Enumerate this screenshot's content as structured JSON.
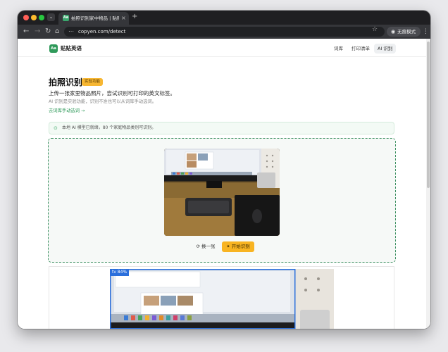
{
  "browser": {
    "tab_title": "拍照识别家中物品 | 贴贴英语 /",
    "tab_close": "×",
    "new_tab": "+",
    "favicon": "Aa",
    "tab_list": "⌄",
    "url": "copyen.com/detect",
    "incognito_label": "无痕模式",
    "nav": {
      "back": "←",
      "forward": "→",
      "reload": "↻",
      "home": "⌂",
      "tune": "⋯",
      "star": "☆",
      "incog_icon": "◉",
      "menu": "⋮"
    }
  },
  "site": {
    "logo": "Aa",
    "brand": "贴贴英语",
    "nav_items": [
      "词库",
      "打印清单",
      "AI 识别"
    ]
  },
  "page": {
    "title": "拍照识别",
    "badge": "实验功能",
    "lead": "上传一张家里物品照片，尝试识别可打印的英文标签。",
    "sub": "AI 识别是实验功能，识别不准也可以从词库手动选词。",
    "manual_link": "去词库手动选词 →",
    "status_icon": "⊙",
    "status": "本地 AI 模型已就绪，80 个家庭物品类别可识别。",
    "swap_button": "换一张",
    "swap_icon": "⟳",
    "start_button": "开始识别",
    "start_icon": "✦",
    "detection_label": "tv 84%"
  },
  "colors": {
    "accent": "#2f9a5a",
    "badge": "#f7b733",
    "start_button": "#f8b422",
    "detection": "#2b6fdc"
  }
}
